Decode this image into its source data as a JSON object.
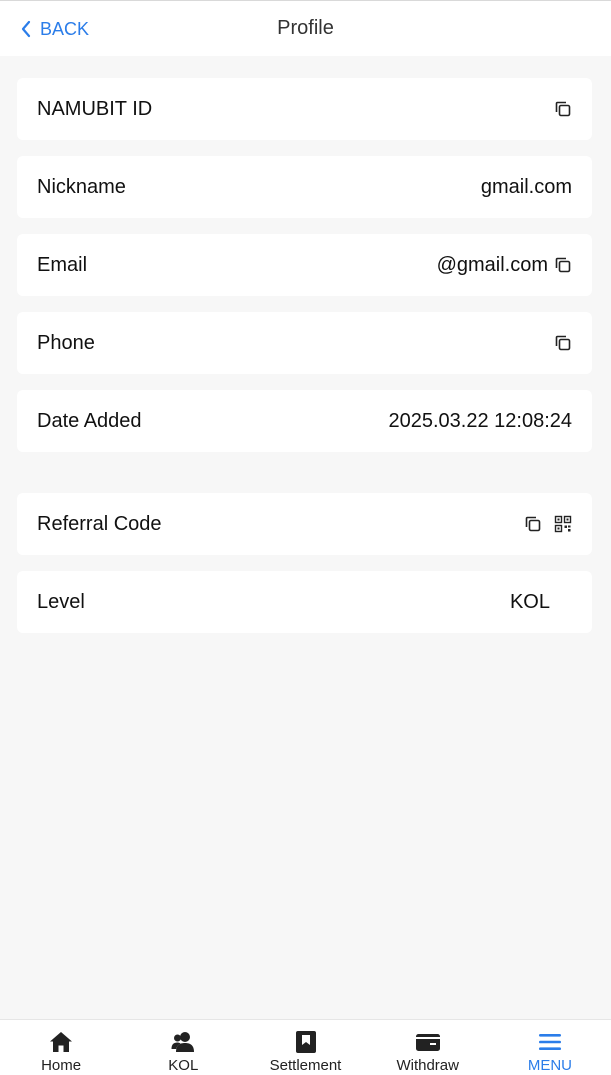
{
  "header": {
    "back_label": "BACK",
    "title": "Profile"
  },
  "rows": [
    {
      "label": "NAMUBIT ID",
      "value": "",
      "icons": [
        "copy-icon"
      ]
    },
    {
      "label": "Nickname",
      "value": "gmail.com",
      "icons": []
    },
    {
      "label": "Email",
      "value": "@gmail.com",
      "icons": [
        "copy-icon"
      ]
    },
    {
      "label": "Phone",
      "value": "",
      "icons": [
        "copy-icon"
      ]
    },
    {
      "label": "Date Added",
      "value": "2025.03.22 12:08:24",
      "icons": []
    },
    {
      "label": "Referral Code",
      "value": "",
      "icons": [
        "copy-icon",
        "qr-code-icon"
      ]
    },
    {
      "label": "Level",
      "value": "KOL",
      "icons": []
    }
  ],
  "tabs": [
    {
      "label": "Home",
      "icon": "home-icon",
      "active": false
    },
    {
      "label": "KOL",
      "icon": "users-icon",
      "active": false
    },
    {
      "label": "Settlement",
      "icon": "bookmark-icon",
      "active": false
    },
    {
      "label": "Withdraw",
      "icon": "wallet-icon",
      "active": false
    },
    {
      "label": "MENU",
      "icon": "menu-icon",
      "active": true
    }
  ],
  "colors": {
    "accent": "#2b7de9",
    "background": "#f7f7f7",
    "card": "#ffffff"
  }
}
